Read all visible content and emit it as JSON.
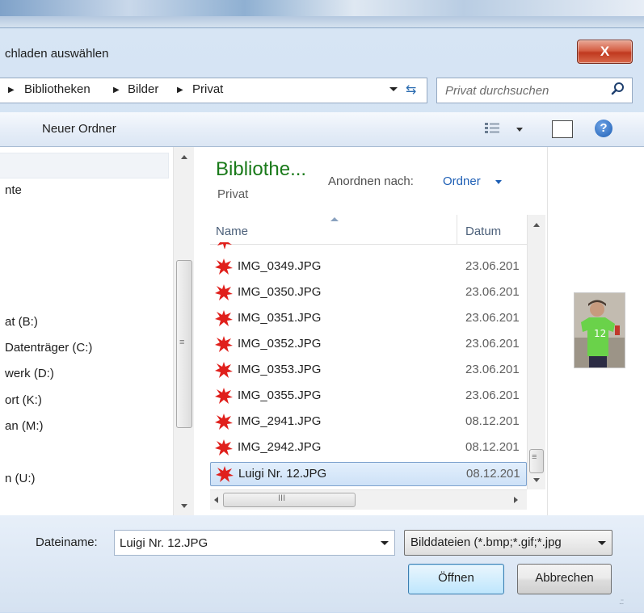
{
  "window": {
    "title": "chladen auswählen",
    "close_label": "X"
  },
  "breadcrumb": {
    "items": [
      "Bibliotheken",
      "Bilder",
      "Privat"
    ]
  },
  "search": {
    "placeholder": "Privat durchsuchen"
  },
  "toolbar": {
    "new_folder": "Neuer Ordner",
    "help_label": "?"
  },
  "navigation": {
    "items": [
      "nte",
      "at (B:)",
      "Datenträger (C:)",
      "werk (D:)",
      "ort (K:)",
      "an (M:)",
      "n (U:)"
    ]
  },
  "library": {
    "title": "Bibliothe...",
    "subtitle": "Privat",
    "arrange_label": "Anordnen nach:",
    "arrange_value": "Ordner"
  },
  "columns": {
    "name": "Name",
    "date": "Datum"
  },
  "files": [
    {
      "name": "IMG_0349.JPG",
      "date": "23.06.201"
    },
    {
      "name": "IMG_0350.JPG",
      "date": "23.06.201"
    },
    {
      "name": "IMG_0351.JPG",
      "date": "23.06.201"
    },
    {
      "name": "IMG_0352.JPG",
      "date": "23.06.201"
    },
    {
      "name": "IMG_0353.JPG",
      "date": "23.06.201"
    },
    {
      "name": "IMG_0355.JPG",
      "date": "23.06.201"
    },
    {
      "name": "IMG_2941.JPG",
      "date": "08.12.201"
    },
    {
      "name": "IMG_2942.JPG",
      "date": "08.12.201"
    },
    {
      "name": "Luigi Nr. 12.JPG",
      "date": "08.12.201",
      "selected": true
    }
  ],
  "bottom": {
    "filename_label": "Dateiname:",
    "filename_value": "Luigi Nr. 12.JPG",
    "filter": "Bilddateien (*.bmp;*.gif;*.jpg",
    "open_button": "Öffnen",
    "cancel_button": "Abbrechen"
  },
  "preview": {
    "shirt_number": "12"
  },
  "colors": {
    "library_title": "#1a7a1a",
    "link": "#1e5fb5",
    "file_icon": "#e0201c",
    "close_button": "#c0391f",
    "selection": "#cde1f7"
  },
  "icons": {
    "file": "paint-splat-icon",
    "search": "search-icon",
    "help": "help-icon",
    "refresh": "refresh-icon"
  }
}
